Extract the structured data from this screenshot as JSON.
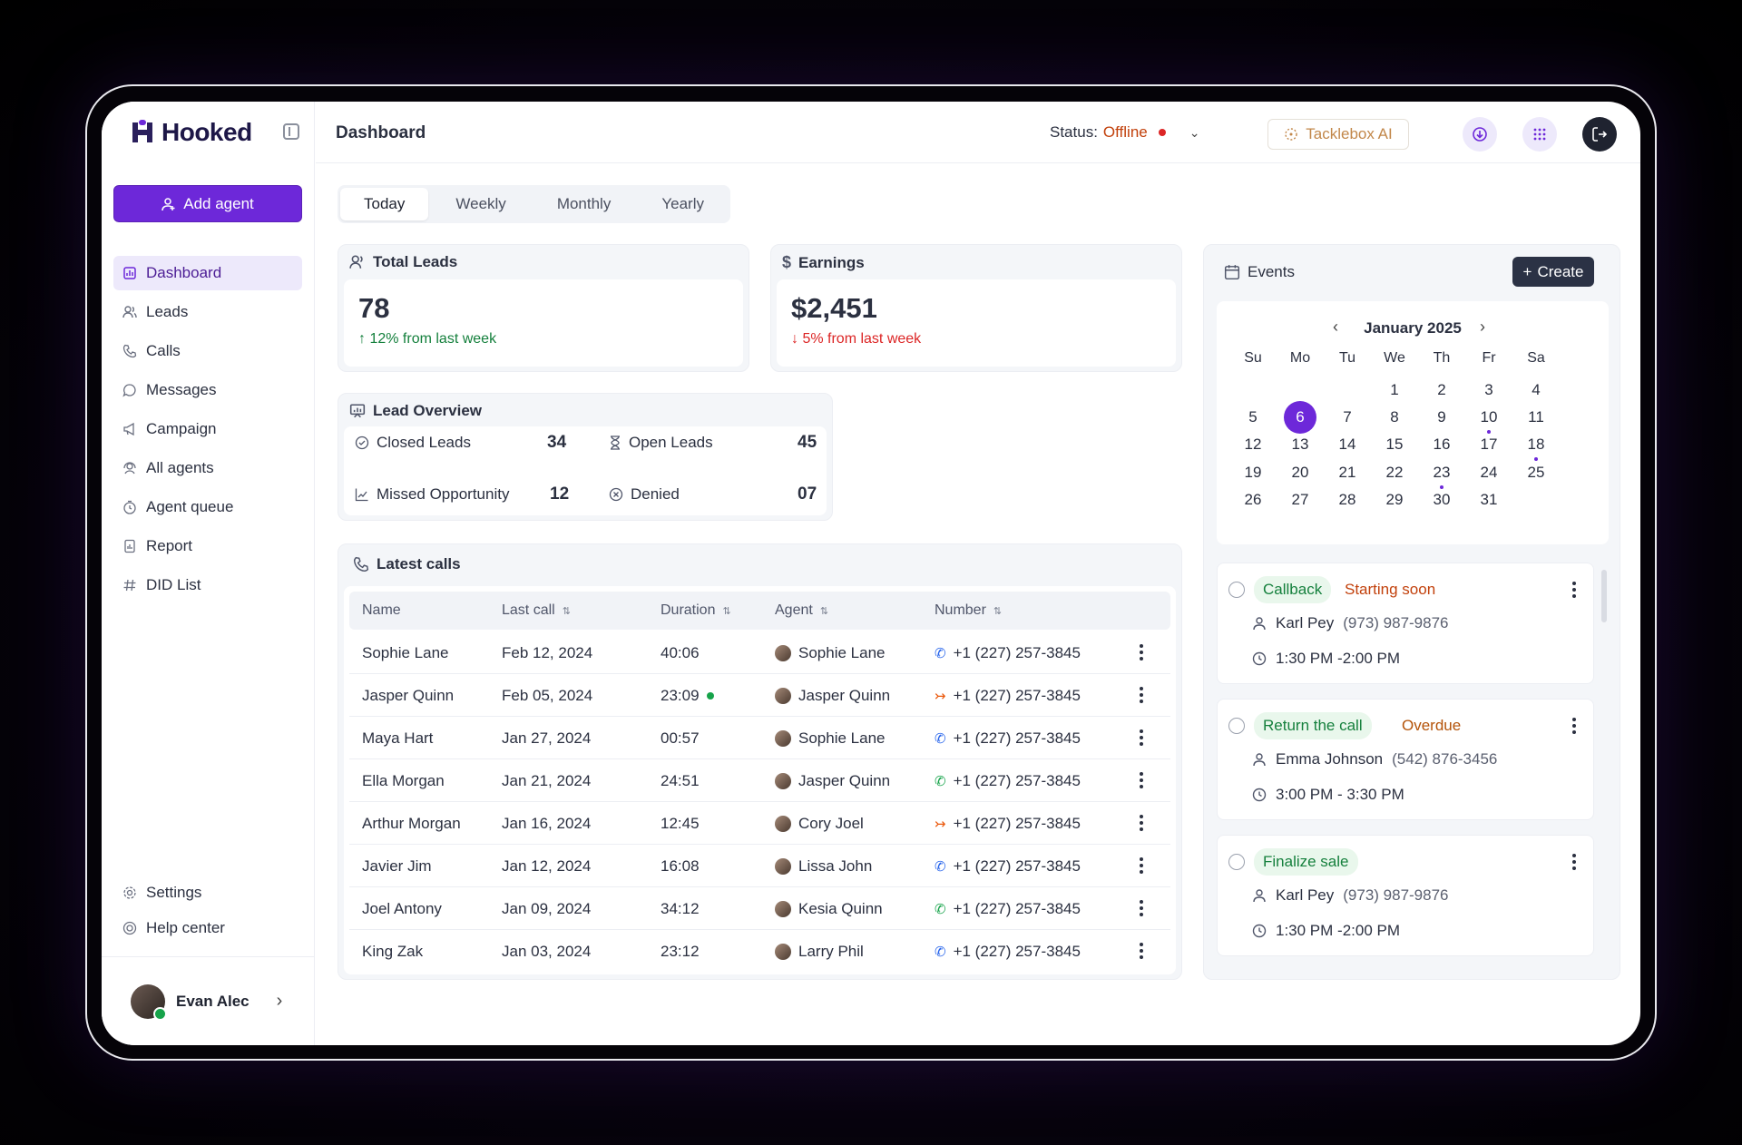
{
  "brand": {
    "name": "Hooked"
  },
  "sidebar": {
    "add_agent": "Add agent",
    "items": [
      {
        "label": "Dashboard",
        "icon": "dashboard-icon"
      },
      {
        "label": "Leads",
        "icon": "users-icon"
      },
      {
        "label": "Calls",
        "icon": "phone-icon"
      },
      {
        "label": "Messages",
        "icon": "chat-icon"
      },
      {
        "label": "Campaign",
        "icon": "megaphone-icon"
      },
      {
        "label": "All agents",
        "icon": "agents-icon"
      },
      {
        "label": "Agent queue",
        "icon": "timer-icon"
      },
      {
        "label": "Report",
        "icon": "report-icon"
      },
      {
        "label": "DID List",
        "icon": "hash-icon"
      }
    ],
    "bottom": [
      {
        "label": "Settings",
        "icon": "gear-icon"
      },
      {
        "label": "Help center",
        "icon": "help-icon"
      }
    ],
    "user": {
      "name": "Evan Alec"
    }
  },
  "header": {
    "title": "Dashboard",
    "status_label": "Status:",
    "status_value": "Offline",
    "tacklebox": "Tacklebox AI"
  },
  "tabs": [
    "Today",
    "Weekly",
    "Monthly",
    "Yearly"
  ],
  "total_leads": {
    "title": "Total Leads",
    "value": "78",
    "delta": "12% from last week"
  },
  "earnings": {
    "title": "Earnings",
    "value": "$2,451",
    "delta": "5% from last week"
  },
  "lead_overview": {
    "title": "Lead Overview",
    "closed": {
      "label": "Closed Leads",
      "value": "34"
    },
    "open": {
      "label": "Open Leads",
      "value": "45"
    },
    "missed": {
      "label": "Missed Opportunity",
      "value": "12"
    },
    "denied": {
      "label": "Denied",
      "value": "07"
    }
  },
  "calls": {
    "title": "Latest calls",
    "columns": [
      "Name",
      "Last call",
      "Duration",
      "Agent",
      "Number"
    ],
    "rows": [
      {
        "name": "Sophie Lane",
        "last": "Feb 12, 2024",
        "dur": "40:06",
        "agent": "Sophie Lane",
        "number": "+1 (227) 257-3845",
        "type": "incoming"
      },
      {
        "name": "Jasper Quinn",
        "last": "Feb 05, 2024",
        "dur": "23:09",
        "agent": "Jasper Quinn",
        "number": "+1 (227) 257-3845",
        "type": "outgoing"
      },
      {
        "name": "Maya Hart",
        "last": "Jan 27, 2024",
        "dur": "00:57",
        "agent": "Sophie Lane",
        "number": "+1 (227) 257-3845",
        "type": "incoming"
      },
      {
        "name": "Ella Morgan",
        "last": "Jan 21, 2024",
        "dur": "24:51",
        "agent": "Jasper Quinn",
        "number": "+1 (227) 257-3845",
        "type": "answered"
      },
      {
        "name": "Arthur Morgan",
        "last": "Jan 16, 2024",
        "dur": "12:45",
        "agent": "Cory Joel",
        "number": "+1 (227) 257-3845",
        "type": "outgoing"
      },
      {
        "name": "Javier Jim",
        "last": "Jan 12, 2024",
        "dur": "16:08",
        "agent": "Lissa John",
        "number": "+1 (227) 257-3845",
        "type": "incoming"
      },
      {
        "name": "Joel Antony",
        "last": "Jan 09, 2024",
        "dur": "34:12",
        "agent": "Kesia Quinn",
        "number": "+1 (227) 257-3845",
        "type": "answered"
      },
      {
        "name": "King Zak",
        "last": "Jan 03, 2024",
        "dur": "23:12",
        "agent": "Larry Phil",
        "number": "+1 (227) 257-3845",
        "type": "incoming"
      }
    ],
    "type_colors": {
      "incoming": "#2563eb",
      "outgoing": "#ea580c",
      "answered": "#16a34a"
    }
  },
  "events": {
    "title": "Events",
    "create": "Create",
    "calendar": {
      "month": "January 2025",
      "dow": [
        "Su",
        "Mo",
        "Tu",
        "We",
        "Th",
        "Fr",
        "Sa"
      ],
      "first_weekday": 3,
      "days": 31,
      "selected": 6,
      "event_days": [
        10,
        18,
        23
      ]
    },
    "items": [
      {
        "tag": "Callback",
        "status": "Starting soon",
        "status_kind": "soon",
        "person": "Karl Pey",
        "phone": "(973) 987-9876",
        "time": "1:30 PM -2:00 PM"
      },
      {
        "tag": "Return the call",
        "status": "Overdue",
        "status_kind": "over",
        "person": "Emma Johnson",
        "phone": "(542) 876-3456",
        "time": "3:00 PM - 3:30 PM"
      },
      {
        "tag": "Finalize sale",
        "status": "",
        "status_kind": "",
        "person": "Karl Pey",
        "phone": "(973) 987-9876",
        "time": "1:30 PM -2:00 PM"
      }
    ]
  }
}
